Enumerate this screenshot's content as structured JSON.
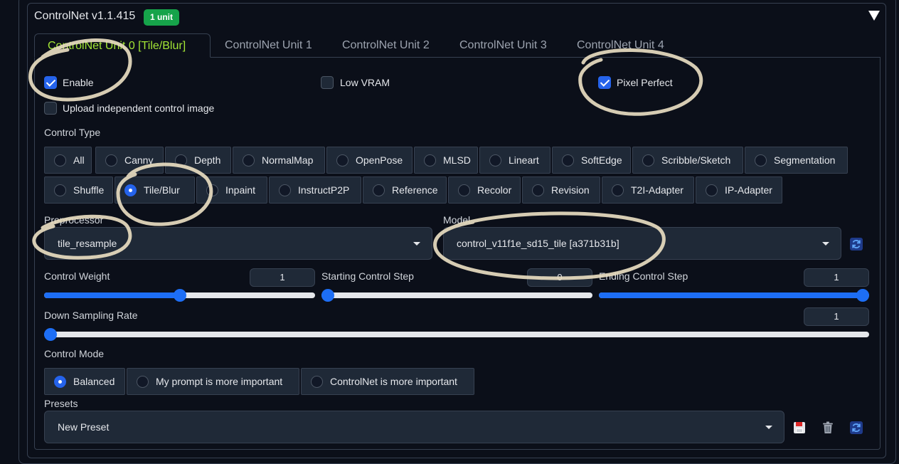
{
  "accordion": {
    "title": "ControlNet v1.1.415",
    "badge": "1 unit"
  },
  "tabs": [
    {
      "label": "ControlNet Unit 0 [Tile/Blur]",
      "active": true
    },
    {
      "label": "ControlNet Unit 1",
      "active": false
    },
    {
      "label": "ControlNet Unit 2",
      "active": false
    },
    {
      "label": "ControlNet Unit 3",
      "active": false
    },
    {
      "label": "ControlNet Unit 4",
      "active": false
    }
  ],
  "checkboxes": {
    "enable": {
      "label": "Enable",
      "checked": true
    },
    "low_vram": {
      "label": "Low VRAM",
      "checked": false
    },
    "pixel_perfect": {
      "label": "Pixel Perfect",
      "checked": true
    },
    "upload_independent": {
      "label": "Upload independent control image",
      "checked": false
    }
  },
  "control_type": {
    "label": "Control Type",
    "selected": "Tile/Blur",
    "options_row1": [
      "All",
      "Canny",
      "Depth",
      "NormalMap",
      "OpenPose",
      "MLSD",
      "Lineart",
      "SoftEdge",
      "Scribble/Sketch",
      "Segmentation"
    ],
    "options_row2": [
      "Shuffle",
      "Tile/Blur",
      "Inpaint",
      "InstructP2P",
      "Reference",
      "Recolor",
      "Revision",
      "T2I-Adapter",
      "IP-Adapter"
    ]
  },
  "preprocessor": {
    "label": "Preprocessor",
    "value": "tile_resample"
  },
  "model": {
    "label": "Model",
    "value": "control_v11f1e_sd15_tile [a371b31b]"
  },
  "sliders": {
    "control_weight": {
      "label": "Control Weight",
      "value": "1",
      "fraction": 0.5
    },
    "starting_step": {
      "label": "Starting Control Step",
      "value": "0",
      "fraction": 0
    },
    "ending_step": {
      "label": "Ending Control Step",
      "value": "1",
      "fraction": 1
    },
    "down_sampling": {
      "label": "Down Sampling Rate",
      "value": "1",
      "fraction": 0
    }
  },
  "control_mode": {
    "label": "Control Mode",
    "selected": "Balanced",
    "options": [
      "Balanced",
      "My prompt is more important",
      "ControlNet is more important"
    ]
  },
  "presets": {
    "label": "Presets",
    "value": "New Preset"
  },
  "icons": {
    "refresh": "refresh-icon",
    "save": "save-icon",
    "delete": "trash-icon"
  },
  "colors": {
    "accent": "#2563eb",
    "active_tab": "#a3e635",
    "badge": "#16a34a"
  }
}
